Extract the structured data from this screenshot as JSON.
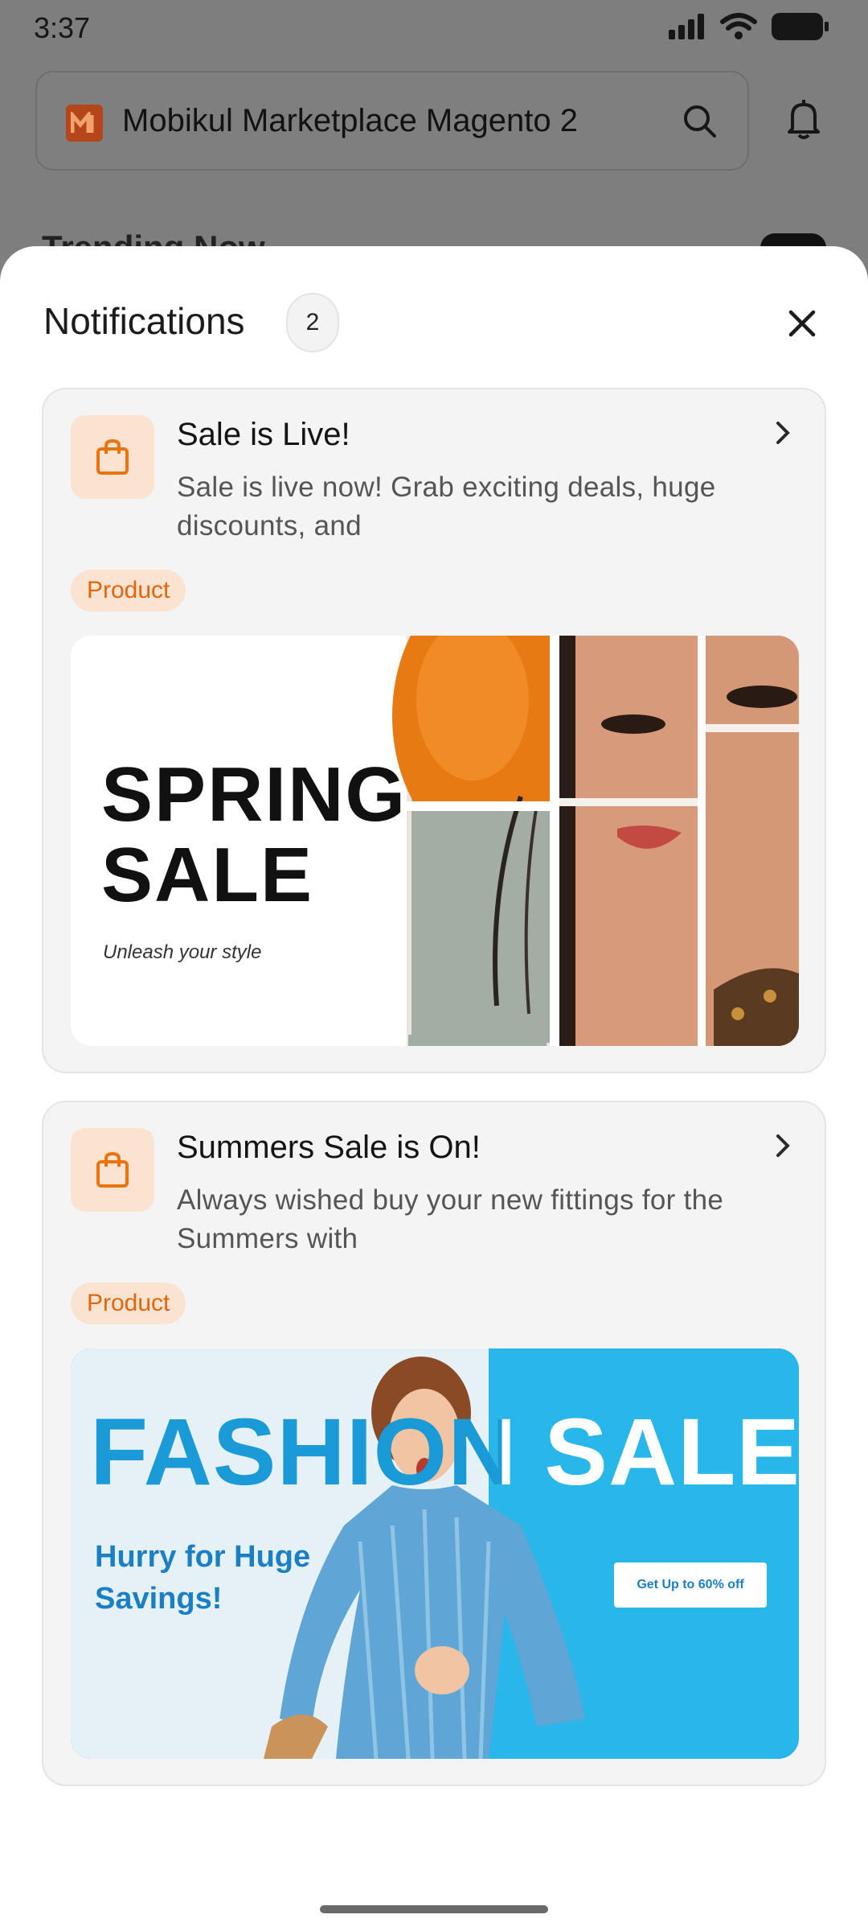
{
  "status_bar": {
    "time": "3:37",
    "icons": [
      "signal-icon",
      "wifi-icon",
      "battery-icon"
    ]
  },
  "app": {
    "title": "Mobikul Marketplace Magento 2",
    "section": "Trending Now"
  },
  "sheet": {
    "title": "Notifications",
    "count": "2",
    "notifications": [
      {
        "title": "Sale is Live!",
        "text": "Sale is live now! Grab exciting deals, huge discounts, and",
        "tag": "Product",
        "banner": {
          "headline_1": "SPRING",
          "headline_2": "SALE",
          "tagline": "Unleash your style"
        }
      },
      {
        "title": "Summers Sale is On!",
        "text": "Always wished buy your new fittings for the Summers with",
        "tag": "Product",
        "banner": {
          "headline": "FASHION SALE",
          "sub_1": "Hurry for Huge",
          "sub_2": "Savings!",
          "cta": "Get Up to 60% off"
        }
      }
    ]
  },
  "colors": {
    "accent": "#E0650C",
    "accent_bg": "#FBE3D2",
    "banner_blue": "#29B6E8",
    "overlay": "#808080"
  }
}
